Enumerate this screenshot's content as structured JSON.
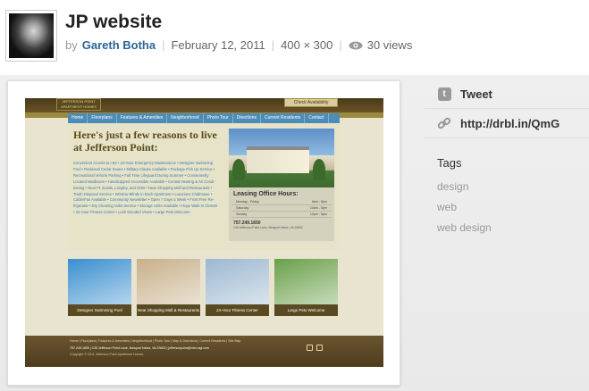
{
  "shot": {
    "title": "JP website",
    "by_label": "by",
    "author": "Gareth Botha",
    "date": "February 12, 2011",
    "dimensions": "400 × 300",
    "views": "30 views",
    "separator": "|"
  },
  "sidebar": {
    "tweet_label": "Tweet",
    "short_url": "http://drbl.in/QmG",
    "tags_title": "Tags",
    "tags": [
      "design",
      "web",
      "web design"
    ]
  },
  "website": {
    "logo_text": "JEFFERSON POINT APARTMENT HOMES",
    "community_button": "Check Availability",
    "nav": [
      "Home",
      "Floorplans",
      "Features & Amenities",
      "Neighborhood",
      "Photo Tour",
      "Directions",
      "Current Residents",
      "Contact"
    ],
    "headline": "Here's just a few reasons to live at Jefferson Point:",
    "features": [
      "Convenient Access to I-64 • 24-Hour Emergency Maintenance • Designer Swimming",
      "Pool • Redwood Cedar Sauna • Military Clause Available • Package Pick Up Service •",
      "Recreational Vehicle Parking • Full Time Lifeguard During Summer • Conveniently",
      "Located Mailboxes • Handicapped Accessible Available • Central Heating & Air Condi-",
      "tioning • Near Ft. Eustis, Langley, and NOB • Near Shopping Mall and Restaurants •",
      "Trash Disposal Service • Window Blinds in Each Apartment • Luxurious Clubhouse •",
      "Cable/Fax Available • Community Newsletter • Open 7 Days a Week • Frost Free Re-",
      "frigerator • Dry Cleaning Valet Service • Storage Units Available • Huge Walk-in Closets",
      "• 24-Hour Fitness Center • Lush Wooded Views • Large Pets Welcome"
    ],
    "office_hours": {
      "title": "Leasing Office Hours:",
      "rows": [
        {
          "day": "Monday - Friday",
          "time": "9am - 6pm"
        },
        {
          "day": "Saturday",
          "time": "10am - 5pm"
        },
        {
          "day": "Sunday",
          "time": "12pm - 5pm"
        }
      ],
      "phone": "757.249.1650",
      "address": "135 Jefferson Point Lane, Newport News, VA 23602"
    },
    "thumbs": [
      {
        "caption": "Designer Swimming Pool",
        "color": "#3a8fd0"
      },
      {
        "caption": "Near Shopping Mall & Restaurants",
        "color": "#c8b08a"
      },
      {
        "caption": "24-Hour Fitness Center",
        "color": "#9cb8d0"
      },
      {
        "caption": "Large Pets Welcome",
        "color": "#6aa04a"
      }
    ],
    "footer_links": "Home | Floorplans | Features & Amenities | Neighborhood | Photo Tour | Map & Directions | Current Residents | Site Map",
    "footer_contact": "757.249.1650 | 135 Jefferson Point Lane, Newport News, VA 23602 | jeffersonpoint@mtn.mgl.com",
    "footer_copyright": "Copyright © 2011 Jefferson Point Apartment Homes"
  }
}
